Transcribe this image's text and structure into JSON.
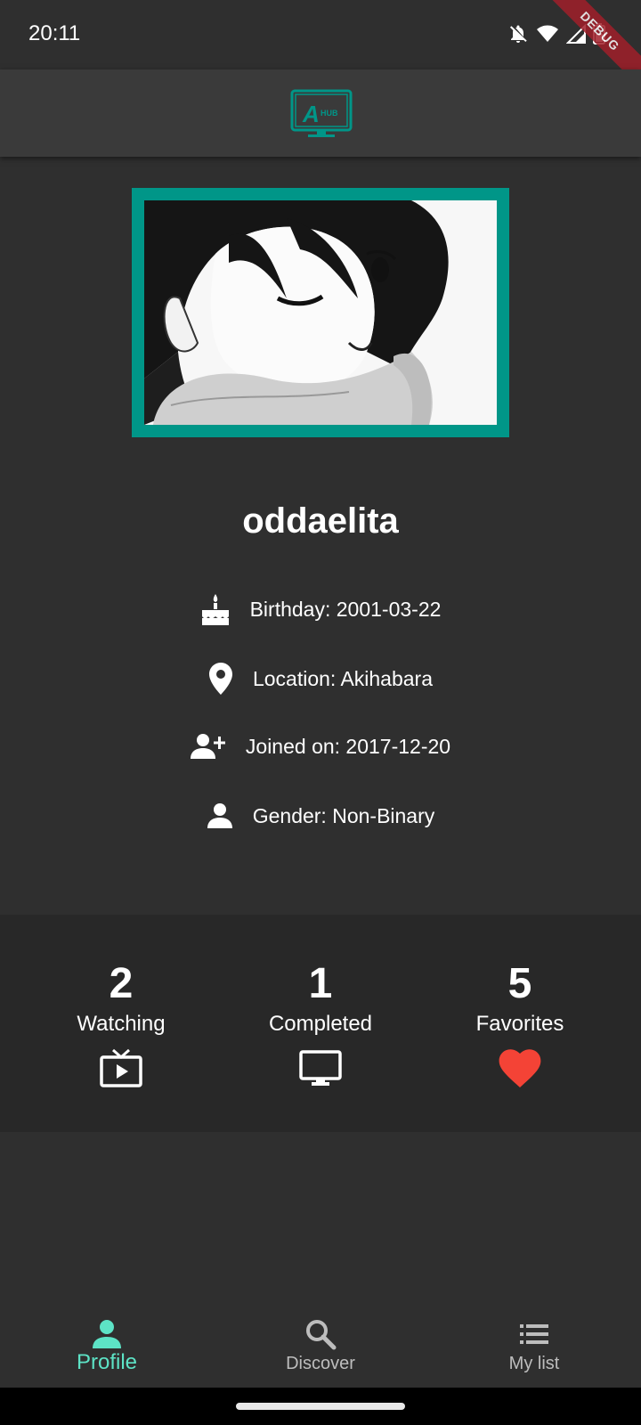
{
  "status": {
    "time": "20:11",
    "debug_label": "DEBUG"
  },
  "logo_text": "AHUB",
  "profile": {
    "username": "oddaelita",
    "info": [
      {
        "icon": "cake-icon",
        "text": "Birthday: 2001-03-22"
      },
      {
        "icon": "location-pin-icon",
        "text": "Location: Akihabara"
      },
      {
        "icon": "person-add-icon",
        "text": "Joined on: 2017-12-20"
      },
      {
        "icon": "person-icon",
        "text": "Gender: Non-Binary"
      }
    ]
  },
  "stats": [
    {
      "value": "2",
      "label": "Watching",
      "icon": "live-tv-icon"
    },
    {
      "value": "1",
      "label": "Completed",
      "icon": "desktop-icon"
    },
    {
      "value": "5",
      "label": "Favorites",
      "icon": "heart-icon"
    }
  ],
  "nav": [
    {
      "label": "Profile",
      "icon": "person-icon",
      "active": true
    },
    {
      "label": "Discover",
      "icon": "search-icon",
      "active": false
    },
    {
      "label": "My list",
      "icon": "list-icon",
      "active": false
    }
  ],
  "colors": {
    "accent": "#009688",
    "nav_active": "#5de3c6",
    "heart": "#f44336",
    "background": "#2f2f2f",
    "stats_band": "#282828"
  }
}
